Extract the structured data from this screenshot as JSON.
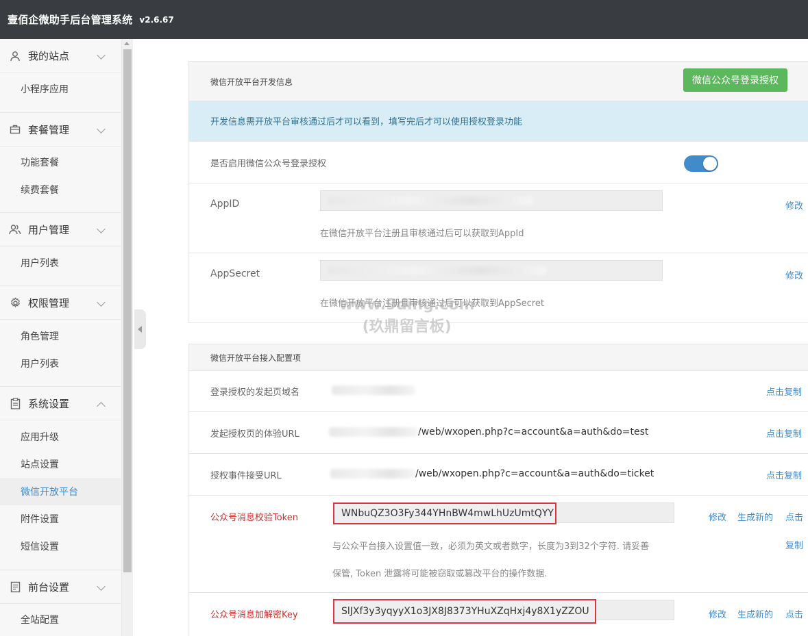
{
  "header": {
    "title": "壹佰企微助手后台管理系统",
    "version": "v2.6.67"
  },
  "sidebar": {
    "sections": [
      {
        "label": "我的站点",
        "icon": "user-icon",
        "items": [
          "小程序应用"
        ]
      },
      {
        "label": "套餐管理",
        "icon": "briefcase-icon",
        "items": [
          "功能套餐",
          "续费套餐"
        ]
      },
      {
        "label": "用户管理",
        "icon": "users-icon",
        "items": [
          "用户列表"
        ]
      },
      {
        "label": "权限管理",
        "icon": "gear-icon",
        "items": [
          "角色管理",
          "用户列表"
        ]
      },
      {
        "label": "系统设置",
        "icon": "clipboard-icon",
        "items": [
          "应用升级",
          "站点设置",
          "微信开放平台",
          "附件设置",
          "短信设置"
        ]
      },
      {
        "label": "前台设置",
        "icon": "document-icon",
        "items": [
          "全站配置"
        ]
      }
    ],
    "active_item": "微信开放平台"
  },
  "dev_panel": {
    "title": "微信开放平台开发信息",
    "auth_button": "微信公众号登录授权",
    "alert": "开发信息需开放平台审核通过后才可以看到，填写完后才可以使用授权登录功能",
    "toggle_label": "是否启用微信公众号登录授权",
    "toggle_on": true,
    "appid_label": "AppID",
    "appid_help": "在微信开放平台注册且审核通过后可以获取到AppId",
    "appsecret_label": "AppSecret",
    "appsecret_help": "在微信开放平台注册且审核通过后可以获取到AppSecret",
    "edit_link": "修改"
  },
  "watermark": {
    "line1": "www.9ding.com",
    "line2": "(玖鼎留言板)"
  },
  "config_panel": {
    "title": "微信开放平台接入配置项",
    "domain_label": "登录授权的发起页域名",
    "test_url_label": "发起授权页的体验URL",
    "test_url_value": "/web/wxopen.php?c=account&a=auth&do=test",
    "ticket_url_label": "授权事件接受URL",
    "ticket_url_value": "/web/wxopen.php?c=account&a=auth&do=ticket",
    "copy_link": "点击复制",
    "token_label": "公众号消息校验Token",
    "token_value": "WNbuQZ3O3Fy344YHnBW4mwLhUzUmtQYY",
    "token_help_line1": "与公众平台接入设置值一致，必须为英文或者数字，长度为3到32个字符. 请妥善",
    "token_help_line2": "保管, Token 泄露将可能被窃取或篡改平台的操作数据.",
    "key_label": "公众号消息加解密Key",
    "key_value": "SlJXf3y3yqyyX1o3JX8J8373YHuXZqHxj4y8X1yZZOU",
    "edit": "修改",
    "generate": "生成新的",
    "click": "点击",
    "copy": "复制"
  }
}
